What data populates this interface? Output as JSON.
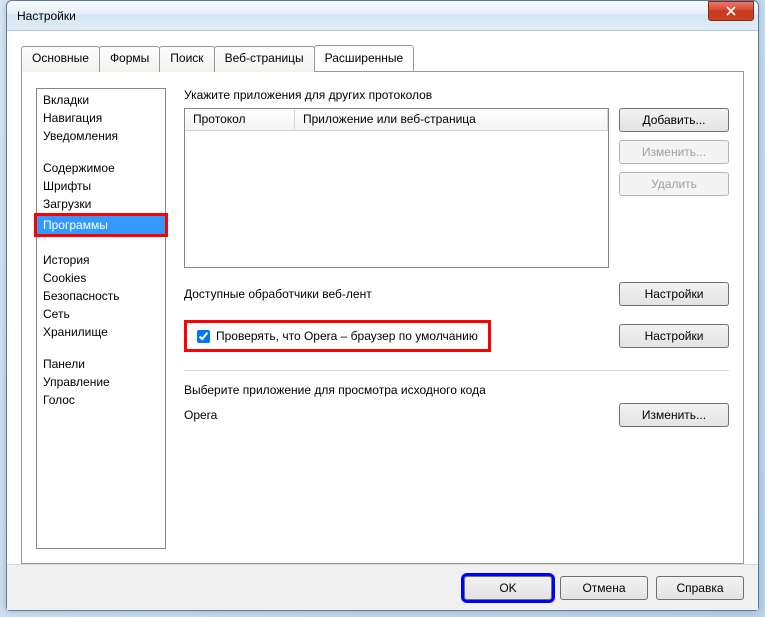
{
  "window": {
    "title": "Настройки"
  },
  "tabs": [
    {
      "label": "Основные"
    },
    {
      "label": "Формы"
    },
    {
      "label": "Поиск"
    },
    {
      "label": "Веб-страницы"
    },
    {
      "label": "Расширенные",
      "active": true
    }
  ],
  "sidebar": {
    "groups": [
      [
        "Вкладки",
        "Навигация",
        "Уведомления"
      ],
      [
        "Содержимое",
        "Шрифты",
        "Загрузки",
        "Программы"
      ],
      [
        "История",
        "Cookies",
        "Безопасность",
        "Сеть",
        "Хранилище"
      ],
      [
        "Панели",
        "Управление",
        "Голос"
      ]
    ],
    "selected": "Программы"
  },
  "main": {
    "protocols_label": "Укажите приложения для других протоколов",
    "table": {
      "col1": "Протокол",
      "col2": "Приложение или веб-страница"
    },
    "buttons": {
      "add": "Добавить...",
      "edit": "Изменить...",
      "delete": "Удалить"
    },
    "feed_label": "Доступные обработчики веб-лент",
    "feed_btn": "Настройки",
    "default_check_label": "Проверять, что Opera – браузер по умолчанию",
    "default_checked": true,
    "default_btn": "Настройки",
    "source_label": "Выберите приложение для просмотра исходного кода",
    "source_value": "Opera",
    "source_btn": "Изменить..."
  },
  "footer": {
    "ok": "OK",
    "cancel": "Отмена",
    "help": "Справка"
  }
}
